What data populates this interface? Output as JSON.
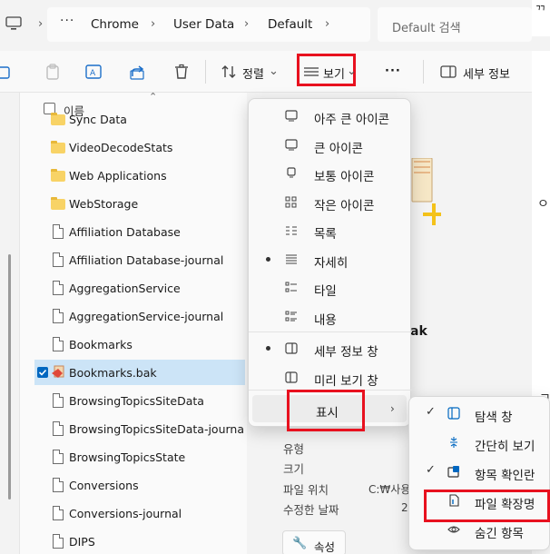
{
  "address": {
    "more": "···",
    "crumbs": [
      "Chrome",
      "User Data",
      "Default"
    ],
    "search_placeholder": "Default 검색"
  },
  "toolbar": {
    "sort_label": "정렬",
    "view_label": "보기",
    "more": "···",
    "details_label": "세부 정보"
  },
  "list": {
    "header": "이름",
    "files": [
      {
        "name": "Sync Data",
        "type": "folder"
      },
      {
        "name": "VideoDecodeStats",
        "type": "folder"
      },
      {
        "name": "Web Applications",
        "type": "folder"
      },
      {
        "name": "WebStorage",
        "type": "folder"
      },
      {
        "name": "Affiliation Database",
        "type": "file"
      },
      {
        "name": "Affiliation Database-journal",
        "type": "file"
      },
      {
        "name": "AggregationService",
        "type": "file"
      },
      {
        "name": "AggregationService-journal",
        "type": "file"
      },
      {
        "name": "Bookmarks",
        "type": "file"
      },
      {
        "name": "Bookmarks.bak",
        "type": "bak",
        "selected": true
      },
      {
        "name": "BrowsingTopicsSiteData",
        "type": "file"
      },
      {
        "name": "BrowsingTopicsSiteData-journal",
        "type": "file"
      },
      {
        "name": "BrowsingTopicsState",
        "type": "file"
      },
      {
        "name": "Conversions",
        "type": "file"
      },
      {
        "name": "Conversions-journal",
        "type": "file"
      },
      {
        "name": "DIPS",
        "type": "file"
      }
    ]
  },
  "details": {
    "title_fragment": "ak",
    "labels": [
      "유형",
      "크기",
      "파일 위치",
      "수정한 날짜"
    ],
    "location_value": "C:₩사용",
    "date_value": "2",
    "props_button": "속성"
  },
  "view_menu": {
    "items": [
      {
        "label": "아주 큰 아이콘",
        "icon": "monitor-icon",
        "active": false
      },
      {
        "label": "큰 아이콘",
        "icon": "monitor-icon",
        "active": false
      },
      {
        "label": "보통 아이콘",
        "icon": "monitor-small-icon",
        "active": false
      },
      {
        "label": "작은 아이콘",
        "icon": "grid-icon",
        "active": false
      },
      {
        "label": "목록",
        "icon": "list-icon",
        "active": false
      },
      {
        "label": "자세히",
        "icon": "details-icon",
        "active": true
      },
      {
        "label": "타일",
        "icon": "tiles-icon",
        "active": false
      },
      {
        "label": "내용",
        "icon": "content-icon",
        "active": false
      },
      {
        "label": "세부 정보 창",
        "icon": "details-pane-icon",
        "active": true
      },
      {
        "label": "미리 보기 창",
        "icon": "preview-pane-icon",
        "active": false
      },
      {
        "label": "표시",
        "icon": "",
        "active": false
      }
    ]
  },
  "show_menu": {
    "items": [
      {
        "label": "탐색 창",
        "checked": true,
        "icon": "nav-pane-icon"
      },
      {
        "label": "간단히 보기",
        "checked": false,
        "icon": "compact-icon"
      },
      {
        "label": "항목 확인란",
        "checked": true,
        "icon": "checkbox-icon"
      },
      {
        "label": "파일 확장명",
        "checked": false,
        "icon": "file-ext-icon"
      },
      {
        "label": "숨긴 항목",
        "checked": false,
        "icon": "eye-icon"
      }
    ]
  },
  "colors": {
    "highlight_red": "#e8111f",
    "selection": "#cce4f7",
    "accent": "#0067c0"
  }
}
